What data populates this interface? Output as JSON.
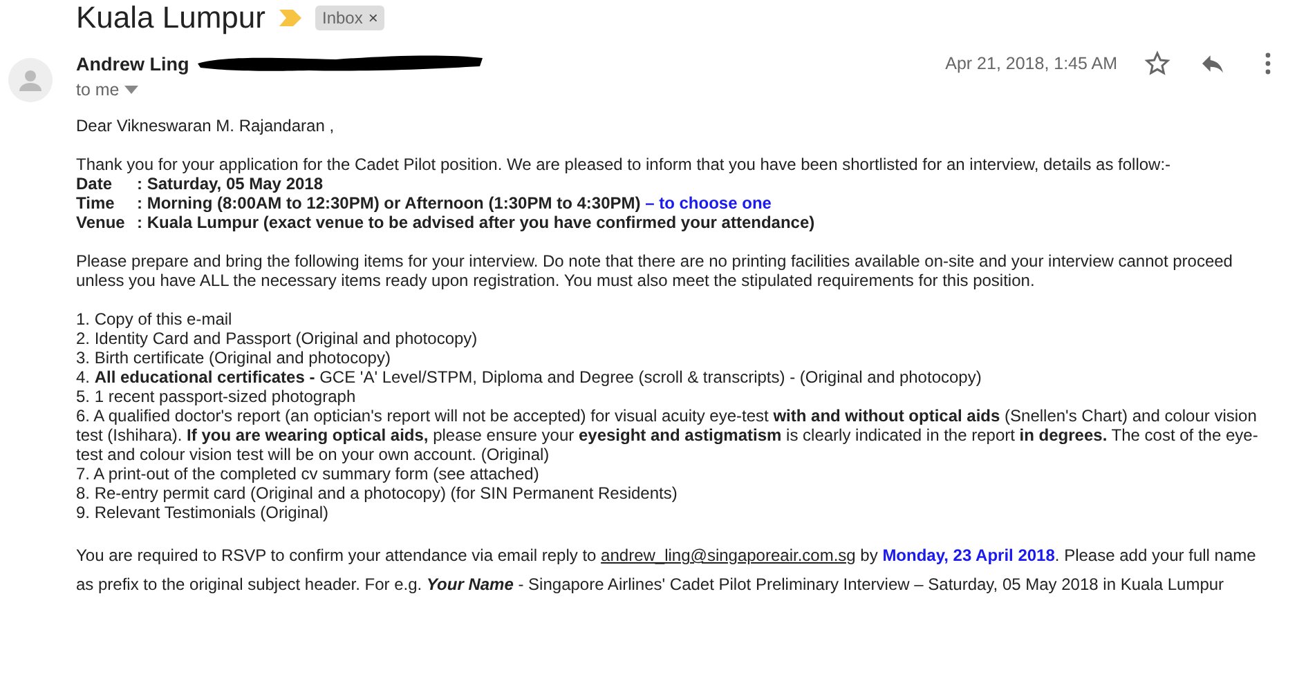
{
  "subject": {
    "title": "Kuala Lumpur",
    "important": true,
    "label": "Inbox",
    "label_close": "×"
  },
  "message": {
    "sender": "Andrew Ling",
    "date": "Apr 21, 2018, 1:45 AM",
    "recipient": "to me",
    "starred": false,
    "greeting": "Dear Vikneswaran M. Rajandaran ,",
    "intro": "Thank you for your application for the Cadet Pilot position. We are pleased to inform that you have been shortlisted for an interview, details as follow:-",
    "details": [
      {
        "label": "Date",
        "value": ": Saturday, 05 May 2018"
      },
      {
        "label": "Time",
        "value": ": Morning (8:00AM to 12:30PM) or Afternoon (1:30PM to 4:30PM)",
        "note": "– to choose one"
      },
      {
        "label": "Venue",
        "value": ": Kuala Lumpur (exact venue to be advised after you have confirmed your attendance)"
      }
    ],
    "instructions": "Please prepare and bring the following items for your interview. Do note that there are no printing facilities available on-site and your interview cannot proceed unless you have ALL the necessary items ready upon registration. You must also meet the stipulated requirements for this position.",
    "items": [
      "1. Copy of this e-mail",
      "2. Identity Card and Passport (Original and photocopy)",
      "3. Birth certificate (Original and photocopy)",
      "4. **All educational certificates -** GCE 'A' Level/STPM, Diploma and Degree (scroll & transcripts) - (Original and photocopy)",
      "5. 1 recent passport-sized photograph",
      "6. A qualified doctor's report (an optician's report will not be accepted) for visual acuity eye-test **with and without optical aids** (Snellen's Chart) and colour vision test (Ishihara). **If you are wearing optical aids,** please ensure your **eyesight and astigmatism** is clearly indicated in the report **in degrees.** The cost of the eye-test and colour vision test will be on your own account. (Original)",
      "7. A print-out of the completed cv summary form (see attached)",
      "8. Re-entry permit card (Original and a photocopy) (for SIN Permanent Residents)",
      "9. Relevant Testimonials (Original)"
    ],
    "rsvp": [
      {
        "kind": "text",
        "text": "You are required to RSVP to confirm your attendance via email reply to "
      },
      {
        "kind": "link",
        "text": "andrew_ling@singaporeair.com.sg"
      },
      {
        "kind": "text",
        "text": " by "
      },
      {
        "kind": "highlight",
        "text": "Monday, 23 April 2018"
      },
      {
        "kind": "text",
        "text": ". Please add your full name as prefix to the original subject header. For e.g. "
      },
      {
        "kind": "emphasis",
        "text": "Your Name"
      },
      {
        "kind": "text",
        "text": " - Singapore Airlines' Cadet Pilot Preliminary Interview – Saturday, 05 May 2018 in Kuala Lumpur"
      }
    ]
  }
}
